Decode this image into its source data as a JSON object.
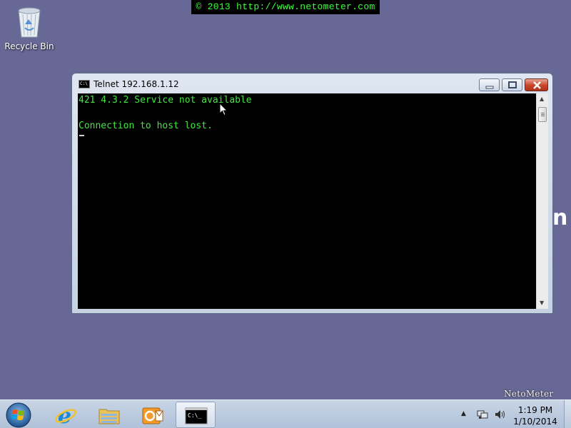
{
  "banner": {
    "text": "© 2013 http://www.netometer.com"
  },
  "desktop": {
    "icons": [
      {
        "label": "Recycle Bin",
        "icon": "recycle-bin-icon"
      }
    ],
    "edge_glyph": "n"
  },
  "window": {
    "title": "Telnet 192.168.1.12",
    "icon": "command-prompt-icon",
    "controls": [
      "minimize",
      "maximize",
      "close"
    ]
  },
  "console": {
    "lines": [
      "421 4.3.2 Service not available",
      "",
      "Connection to host lost."
    ],
    "text_color": "#43e643",
    "background": "#000000"
  },
  "taskbar": {
    "items": [
      {
        "name": "start-button",
        "icon": "windows-logo-icon"
      },
      {
        "name": "internet-explorer",
        "icon": "internet-explorer-icon"
      },
      {
        "name": "windows-explorer",
        "icon": "folder-icon"
      },
      {
        "name": "outlook",
        "icon": "outlook-icon"
      },
      {
        "name": "telnet",
        "icon": "command-prompt-icon",
        "active": true
      }
    ],
    "tray": {
      "icons": [
        "show-hidden-icons-arrow",
        "network-icon",
        "volume-icon"
      ],
      "time": "1:19 PM",
      "date": "1/10/2014"
    }
  },
  "watermark": {
    "text": "NetoMeter"
  },
  "colors": {
    "desktop": "#686896",
    "banner_text": "#3cff3c",
    "close_button": "#c8442b"
  }
}
